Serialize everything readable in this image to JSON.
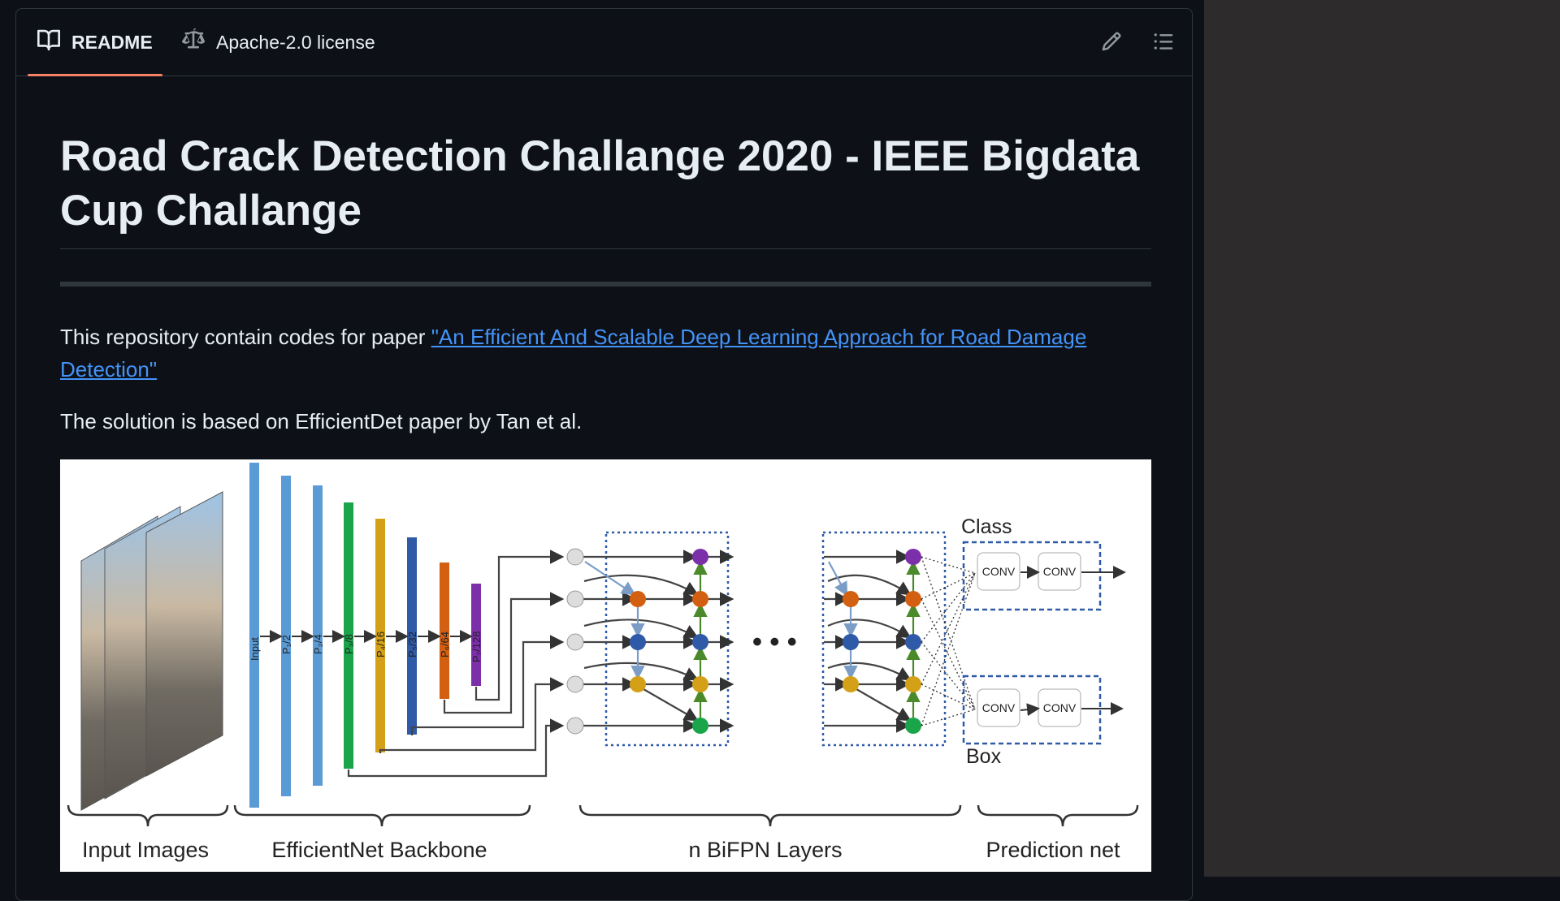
{
  "tabs": {
    "readme_label": "README",
    "license_label": "Apache-2.0 license"
  },
  "readme": {
    "title": "Road Crack Detection Challange 2020 - IEEE Bigdata Cup Challange",
    "intro_text": "This repository contain codes for paper ",
    "paper_link_text": "\"An Efficient And Scalable Deep Learning Approach for Road Damage Detection\"",
    "solution_text": "The solution is based on EfficientDet paper by Tan et al."
  },
  "figure": {
    "backbone_labels": [
      "Input",
      "P₁/2",
      "P₂/4",
      "P₃/8",
      "P₄/16",
      "P₅/32",
      "P₆/64",
      "P₇/128"
    ],
    "class_label": "Class",
    "box_label": "Box",
    "conv_label": "CONV",
    "ellipsis": "• • •",
    "section_labels": {
      "input_images": "Input Images",
      "backbone": "EfficientNet Backbone",
      "bifpn": "n BiFPN Layers",
      "prediction": "Prediction net"
    }
  },
  "icons": {
    "readme_tab": "book-icon",
    "license_tab": "law-scale-icon",
    "edit": "pencil-icon",
    "outline": "list-unordered-icon"
  },
  "colors": {
    "background": "#0d1117",
    "border": "#30363d",
    "text": "#e6edf3",
    "link": "#4493f8",
    "tab_underline": "#f78166",
    "gutter": "#2d2b2b"
  }
}
